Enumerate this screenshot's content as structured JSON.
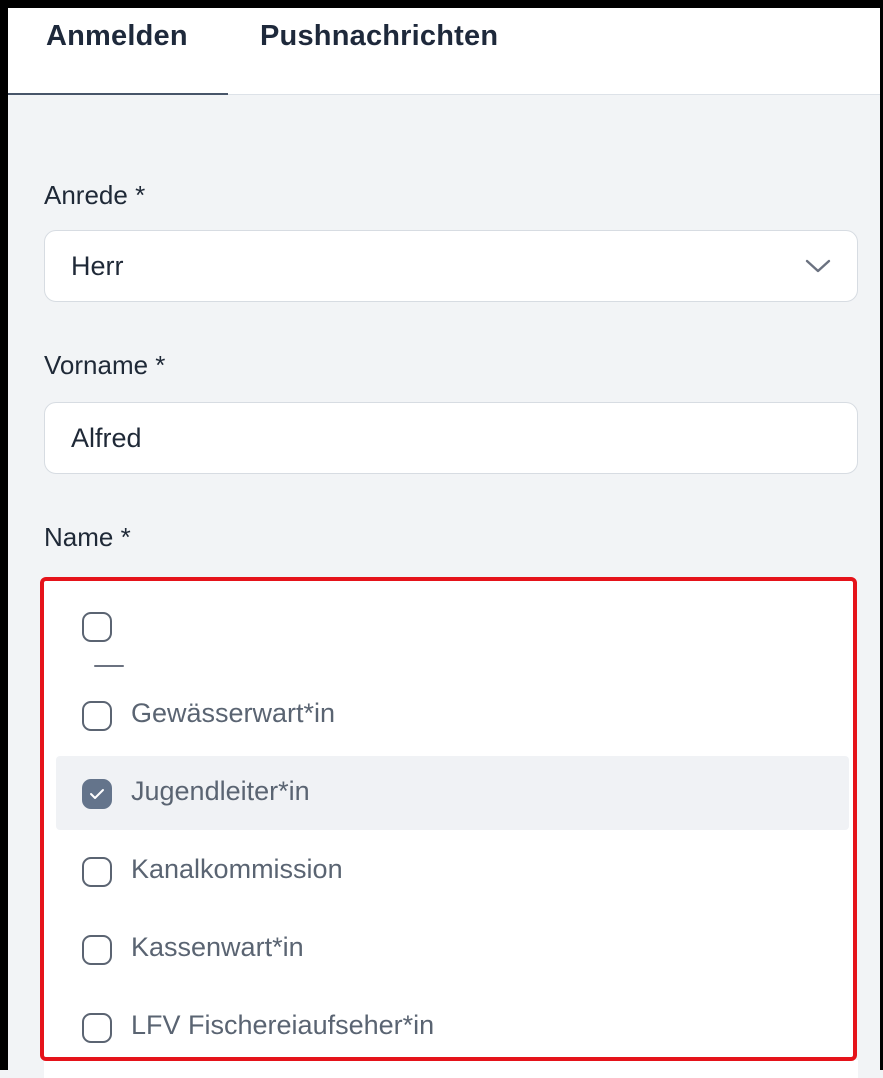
{
  "tabs": {
    "login": "Anmelden",
    "push": "Pushnachrichten"
  },
  "form": {
    "salutation_label": "Anrede *",
    "salutation_value": "Herr",
    "firstname_label": "Vorname *",
    "firstname_value": "Alfred",
    "name_label": "Name *"
  },
  "dropdown": {
    "options": [
      {
        "label": "",
        "checked": false
      },
      {
        "label": "Gewässerwart*in",
        "checked": false
      },
      {
        "label": "Jugendleiter*in",
        "checked": true
      },
      {
        "label": "Kanalkommission",
        "checked": false
      },
      {
        "label": "Kassenwart*in",
        "checked": false
      },
      {
        "label": "LFV Fischereiaufseher*in",
        "checked": false
      }
    ]
  },
  "colors": {
    "highlight_border": "#e5131a",
    "checkbox_checked": "#64748b",
    "selected_row_bg": "#f0f2f5"
  }
}
